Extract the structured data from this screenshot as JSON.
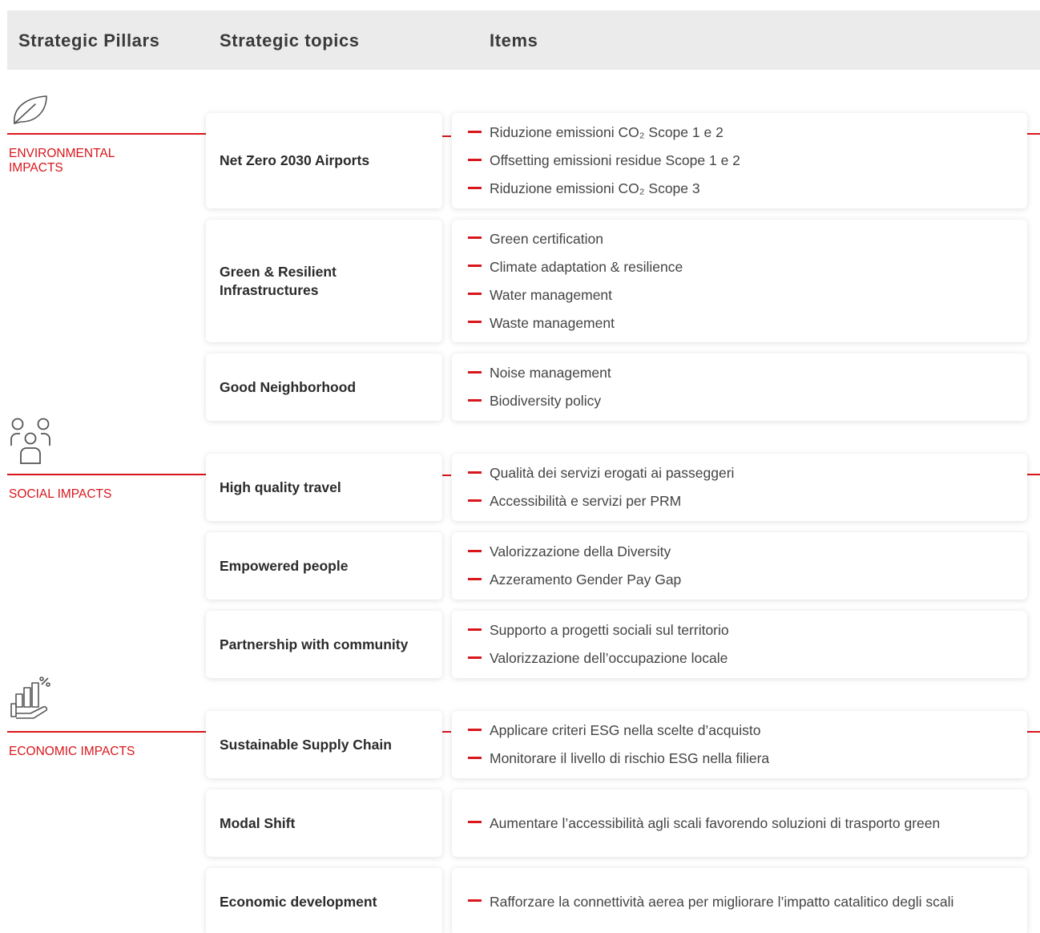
{
  "header": {
    "pillars": "Strategic Pillars",
    "topics": "Strategic topics",
    "items": "Items"
  },
  "pillars": [
    {
      "label": "ENVIRONMENTAL IMPACTS",
      "icon": "leaf-icon"
    },
    {
      "label": "SOCIAL IMPACTS",
      "icon": "people-icon"
    },
    {
      "label": "ECONOMIC IMPACTS",
      "icon": "growth-hand-icon"
    }
  ],
  "rows": [
    {
      "topic": "Net Zero 2030 Airports",
      "items": [
        "Riduzione emissioni CO₂ Scope 1 e 2",
        "Offsetting emissioni residue Scope 1 e 2",
        "Riduzione emissioni CO₂ Scope 3"
      ]
    },
    {
      "topic": "Green & Resilient Infrastructures",
      "items": [
        "Green certification",
        "Climate adaptation & resilience",
        "Water management",
        "Waste management"
      ]
    },
    {
      "topic": "Good Neighborhood",
      "items": [
        "Noise management",
        "Biodiversity policy"
      ]
    },
    {
      "topic": "High quality travel",
      "items": [
        "Qualità dei servizi erogati ai passeggeri",
        "Accessibilità e servizi per PRM"
      ]
    },
    {
      "topic": "Empowered people",
      "items": [
        "Valorizzazione della Diversity",
        "Azzeramento Gender Pay Gap"
      ]
    },
    {
      "topic": "Partnership with community",
      "items": [
        "Supporto a progetti sociali sul territorio",
        "Valorizzazione dell’occupazione locale"
      ]
    },
    {
      "topic": "Sustainable Supply Chain",
      "items": [
        "Applicare criteri ESG nella scelte d’acquisto",
        "Monitorare il livello di rischio ESG nella filiera"
      ]
    },
    {
      "topic": "Modal Shift",
      "items": [
        "Aumentare l’accessibilità agli scali favorendo soluzioni di trasporto green"
      ]
    },
    {
      "topic": "Economic development",
      "items": [
        "Rafforzare la connettività aerea per migliorare l’impatto catalitico degli scali"
      ]
    }
  ],
  "colors": {
    "accent": "#d9161c",
    "header_bg": "#ebebeb"
  }
}
